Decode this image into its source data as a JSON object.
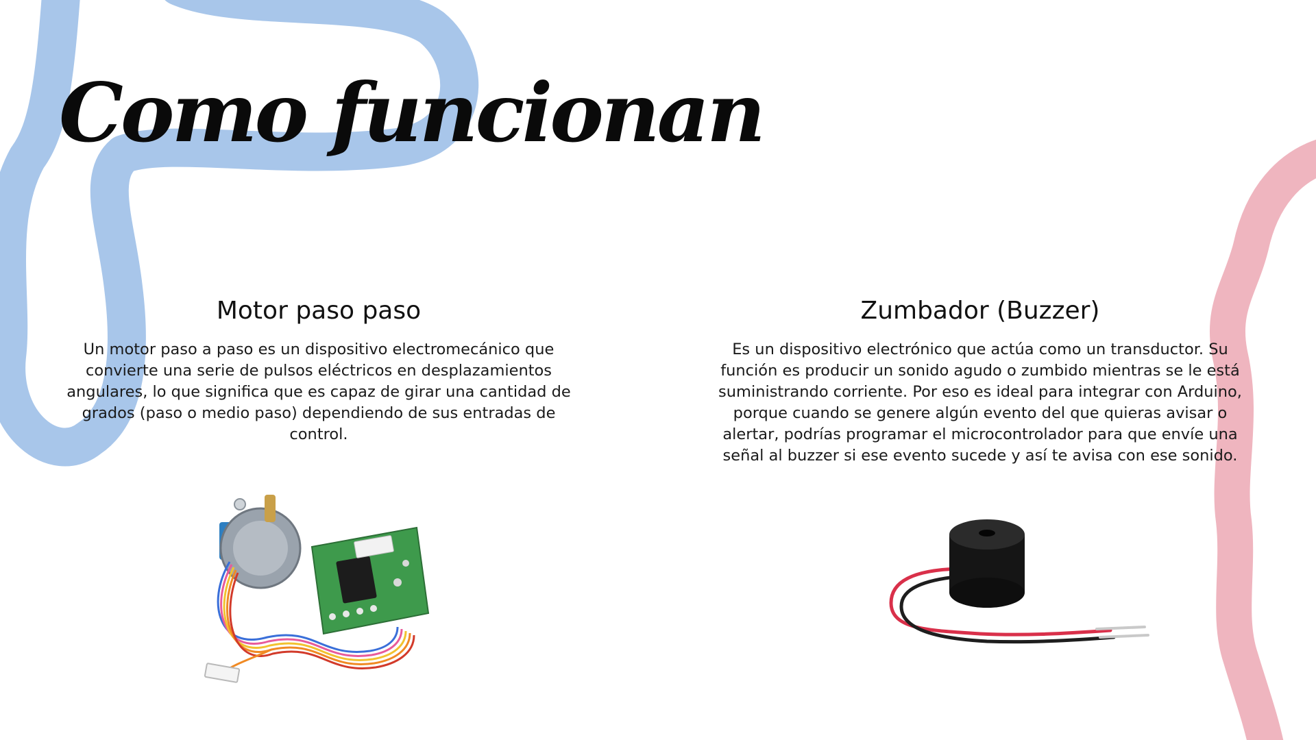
{
  "title": "Como funcionan",
  "colors": {
    "blue_stroke": "#a8c6ea",
    "pink_stroke": "#efb5bf",
    "text": "#111111"
  },
  "sections": [
    {
      "heading": "Motor paso paso",
      "body": "Un motor paso a paso es un dispositivo electromecánico que convierte una serie de pulsos eléctricos en desplazamientos angulares, lo que significa que es capaz de girar una cantidad de grados (paso o medio paso) dependiendo de sus entradas de control.",
      "image": "stepper-motor-with-driver-board-photo"
    },
    {
      "heading": "Zumbador (Buzzer)",
      "body": "Es un dispositivo electrónico que actúa como un transductor. Su función es producir un sonido agudo o zumbido mientras se le está suministrando corriente. Por eso es ideal para integrar con Arduino, porque cuando se genere algún evento del que quieras avisar o alertar, podrías programar el microcontrolador para que envíe una señal al buzzer si ese evento sucede y así te avisa con ese sonido.",
      "image": "buzzer-photo"
    }
  ]
}
